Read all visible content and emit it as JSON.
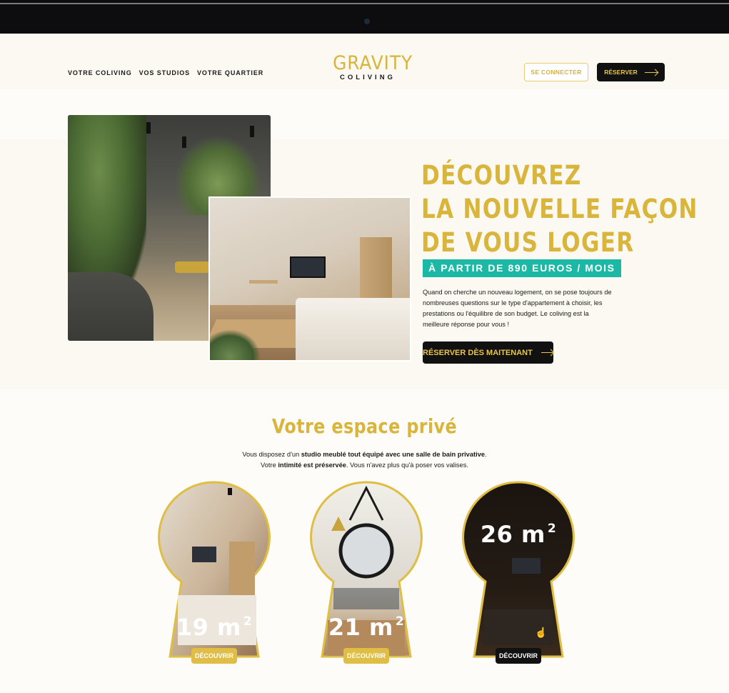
{
  "nav": {
    "items": [
      "VOTRE COLIVING",
      "VOS STUDIOS",
      "VOTRE QUARTIER"
    ]
  },
  "logo": {
    "line1": "GRAVITY",
    "line2": "COLIVING"
  },
  "header": {
    "login_label": "SE CONNECTER",
    "book_label": "RÉSERVER"
  },
  "hero": {
    "title_lines": [
      "DÉCOUVREZ",
      "LA NOUVELLE FAÇON",
      "DE VOUS LOGER"
    ],
    "price": "À PARTIR DE 890 EUROS / MOIS",
    "description": "Quand on cherche un nouveau logement, on se pose toujours de nombreuses questions sur le type d'appartement à choisir, les prestations ou l'équilibre de son budget. Le coliving est la meilleure réponse pour vous !",
    "cta_label": "RÉSERVER DÈS MAITENANT"
  },
  "private": {
    "title": "Votre espace privé",
    "line1_a": "Vous disposez d'un ",
    "line1_b": "studio meublé tout équipé avec une salle de bain privative",
    "line1_c": ".",
    "line2_a": "Votre ",
    "line2_b": "intimité est préservée",
    "line2_c": ". Vous n'avez plus qu'à poser vos valises."
  },
  "studios": [
    {
      "size": "19 m",
      "exp": "2",
      "button": "DÉCOUVRIR"
    },
    {
      "size": "21 m",
      "exp": "2",
      "button": "DÉCOUVRIR"
    },
    {
      "size": "26 m",
      "exp": "2",
      "button": "DÉCOUVRIR"
    }
  ],
  "colors": {
    "gold": "#d9b53b",
    "teal": "#1cb8a6",
    "dark": "#111111"
  }
}
